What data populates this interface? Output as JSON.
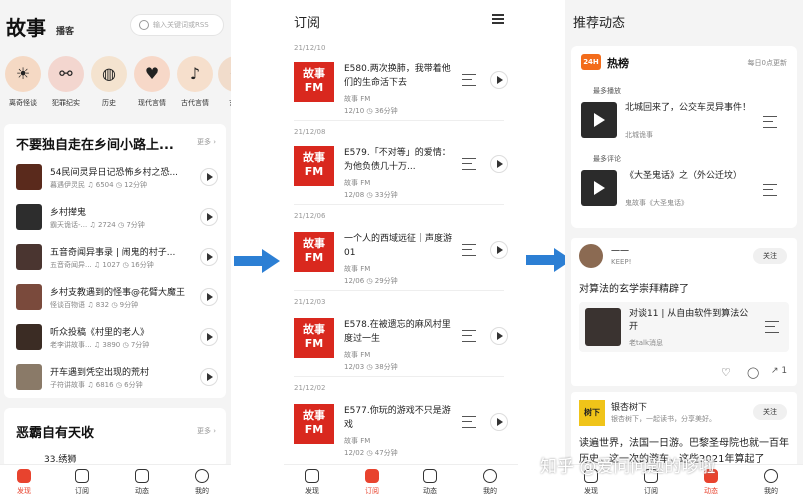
{
  "panel1": {
    "title": "故事",
    "subtitle": "播客",
    "search_placeholder": "输入关键词或RSS",
    "categories": [
      {
        "label": "离奇怪谈",
        "glyph": "☀"
      },
      {
        "label": "犯罪纪实",
        "glyph": "⚯"
      },
      {
        "label": "历史",
        "glyph": "◍"
      },
      {
        "label": "现代言情",
        "glyph": "♥"
      },
      {
        "label": "古代言情",
        "glyph": "♪"
      },
      {
        "label": "玄幻",
        "glyph": "✦"
      }
    ],
    "section1": {
      "title": "不要独自走在乡间小路上...",
      "more": "更多 ›",
      "items": [
        {
          "title": "54民间灵异日记恐怖乡村之恐...",
          "author": "暮遇伊灵民",
          "plays": "6504",
          "duration": "12分钟"
        },
        {
          "title": "乡村撵鬼",
          "author": "霸天诡话-...",
          "plays": "2724",
          "duration": "7分钟"
        },
        {
          "title": "五音奇闻异事录 | 闹鬼的村子...",
          "author": "五音奇闻异...",
          "plays": "1027",
          "duration": "16分钟"
        },
        {
          "title": "乡村支教遇到的怪事@花臂大魔王",
          "author": "怪谈百物语",
          "plays": "832",
          "duration": "9分钟"
        },
        {
          "title": "听众投稿《村里的老人》",
          "author": "老李讲故事...",
          "plays": "3890",
          "duration": "7分钟"
        },
        {
          "title": "开车遇到凭空出现的荒村",
          "author": "子符讲故事",
          "plays": "6816",
          "duration": "6分钟"
        }
      ]
    },
    "section2": {
      "title": "恶霸自有天收",
      "more": "更多 ›",
      "first_item": "33.绣狮"
    },
    "tabs": [
      "发现",
      "订阅",
      "动态",
      "我的"
    ]
  },
  "panel2": {
    "title": "订阅",
    "logo_text": "故事FM",
    "episodes": [
      {
        "date": "21/12/10",
        "title": "E580.两次换肺，我带着他们的生命活下去",
        "source": "故事 FM",
        "day": "12/10",
        "duration": "36分钟"
      },
      {
        "date": "21/12/08",
        "title": "E579.「不对等」的爱情：为他负债几十万...",
        "source": "故事 FM",
        "day": "12/08",
        "duration": "33分钟"
      },
      {
        "date": "21/12/06",
        "title": "一个人的西域远征｜声度游 01",
        "source": "故事 FM",
        "day": "12/06",
        "duration": "29分钟"
      },
      {
        "date": "21/12/03",
        "title": "E578.在被遗忘的麻风村里度过一生",
        "source": "故事 FM",
        "day": "12/03",
        "duration": "38分钟"
      },
      {
        "date": "21/12/02",
        "title": "E577.你玩的游戏不只是游戏",
        "source": "故事 FM",
        "day": "12/02",
        "duration": "47分钟"
      }
    ],
    "tabs": [
      "发现",
      "订阅",
      "动态",
      "我的"
    ]
  },
  "panel3": {
    "title": "推荐动态",
    "hot": {
      "badge": "24H",
      "name": "热榜",
      "update": "每日0点更新",
      "label1": "最多播放",
      "item1": {
        "title": "北城回来了，公交车灵异事件！",
        "source": "北城诡事"
      },
      "label2": "最多评论",
      "item2": {
        "title": "《大圣鬼话》之（外公迁坟）",
        "source": "鬼故事《大圣鬼话》"
      }
    },
    "post1": {
      "user": "一一",
      "sub": "KEEP!",
      "follow": "关注",
      "text": "对算法的玄学崇拜精辟了",
      "item_title": "对谈11 | 从自由软件到算法公开",
      "item_source": "老talk消息",
      "share_count": "1"
    },
    "post2": {
      "user": "银杏树下",
      "sub": "银杏树下，一起读书，分享美好。",
      "follow": "关注",
      "avatar_text": "树下",
      "text": "读遍世界，法国一日游。巴黎圣母院也就一百年历史，这一次的游车，这些2021年算起了"
    },
    "tabs": [
      "发现",
      "订阅",
      "动态",
      "我的"
    ]
  },
  "watermark": "知乎 @爱问问题的哆啦",
  "colors": {
    "accent": "#e8432e",
    "arrow": "#2c7fd4",
    "logo_red": "#d9281e",
    "hot_orange": "#f36c1b"
  }
}
